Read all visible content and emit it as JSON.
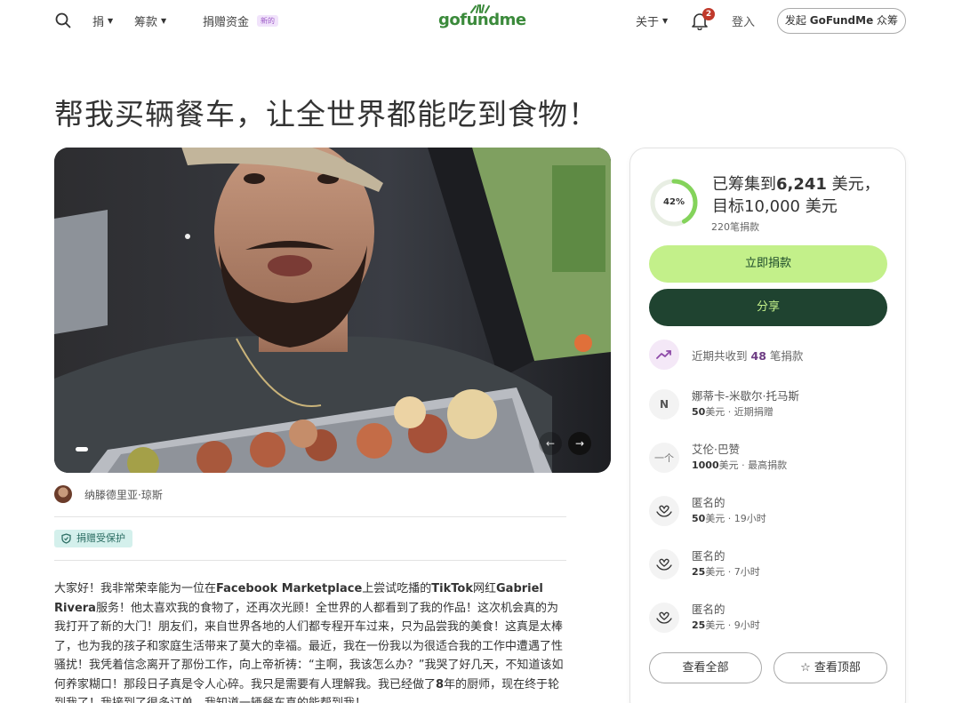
{
  "header": {
    "nav": [
      {
        "label": "捐"
      },
      {
        "label": "筹款"
      }
    ],
    "funds_label": "捐赠资金",
    "funds_badge": "新的",
    "logo": "gofundme",
    "about_label": "关于",
    "notification_count": "2",
    "login_label": "登入",
    "start_prefix": "发起",
    "start_brand": "GoFundMe",
    "start_suffix": "众筹"
  },
  "campaign": {
    "title": "帮我买辆餐车，让全世界都能吃到食物！",
    "organizer": "纳滕德里亚·琼斯",
    "protection_badge": "捐赠受保护",
    "story_segments": [
      {
        "text": "大家好！我非常荣幸能为一位在",
        "bold": false
      },
      {
        "text": "Facebook Marketplace",
        "bold": true
      },
      {
        "text": "上尝试吃播的",
        "bold": false
      },
      {
        "text": "TikTok",
        "bold": true
      },
      {
        "text": "网红",
        "bold": false
      },
      {
        "text": "Gabriel Rivera",
        "bold": true
      },
      {
        "text": "服务！他太喜欢我的食物了，还再次光顾！全世界的人都看到了我的作品！这次机会真的为我打开了新的大门！朋友们，来自世界各地的人们都专程开车过来，只为品尝我的美食！这真是太棒了，也为我的孩子和家庭生活带来了莫大的幸福。最近，我在一份我以为很适合我的工作中遭遇了性骚扰！我凭着信念离开了那份工作，向上帝祈祷：“主啊，我该怎么办？”我哭了好几天，不知道该如何养家糊口！那段日子真是令人心碎。我只是需要有人理解我。我已经做了",
        "bold": false
      },
      {
        "text": "8",
        "bold": true
      },
      {
        "text": "年的厨师，现在终于轮到我了！我接到了很多订单，我知道一辆餐车真的能帮到我！",
        "bold": false
      }
    ]
  },
  "panel": {
    "progress_percent": 42,
    "progress_label": "42%",
    "raised_prefix": "已筹集到",
    "raised_amount": "6,241",
    "raised_mid": " 美元，目标",
    "goal_amount": "10,000",
    "raised_suffix": " 美元",
    "donations_count": "220笔捐款",
    "donate_label": "立即捐款",
    "share_label": "分享",
    "trend_prefix": "近期共收到",
    "trend_count": "48",
    "trend_suffix": "笔捐款",
    "donors": [
      {
        "icon": "N",
        "name": "娜蒂卡-米歇尔·托马斯",
        "amount": "50",
        "unit": "美元",
        "note": " · 近期捐赠"
      },
      {
        "icon": "一个",
        "name": "艾伦·巴赞",
        "amount": "1000",
        "unit": "美元",
        "note": " · 最高捐款"
      },
      {
        "icon": "hands-heart-icon",
        "name": "匿名的",
        "amount": "50",
        "unit": "美元",
        "note": " · 19小时"
      },
      {
        "icon": "hands-heart-icon",
        "name": "匿名的",
        "amount": "25",
        "unit": "美元",
        "note": " · 7小时"
      },
      {
        "icon": "hands-heart-icon",
        "name": "匿名的",
        "amount": "25",
        "unit": "美元",
        "note": " · 9小时"
      }
    ],
    "see_all_label": "查看全部",
    "see_top_label": "查看顶部"
  },
  "colors": {
    "accent_green": "#c3f08a",
    "dark_green": "#1f4330",
    "logo_green": "#3b8a3b",
    "trend_purple": "#6d3c83"
  }
}
